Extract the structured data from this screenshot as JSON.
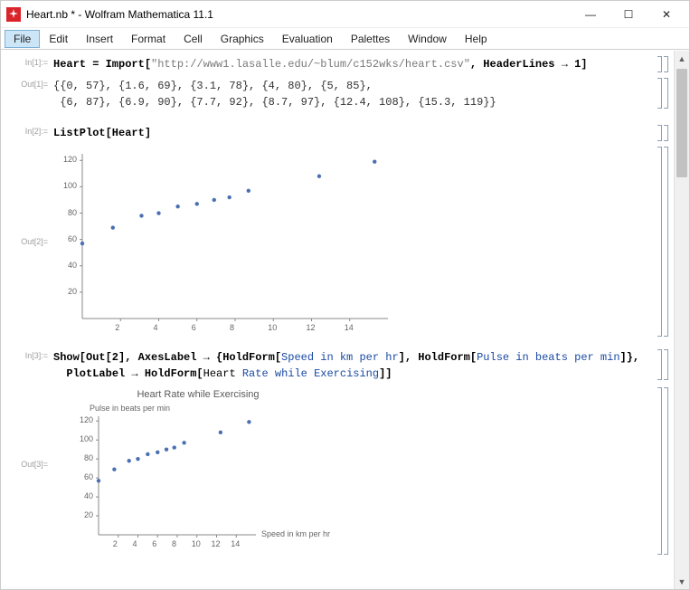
{
  "window": {
    "title": "Heart.nb * - Wolfram Mathematica 11.1",
    "minimize": "—",
    "maximize": "☐",
    "close": "✕"
  },
  "menu": [
    "File",
    "Edit",
    "Insert",
    "Format",
    "Cell",
    "Graphics",
    "Evaluation",
    "Palettes",
    "Window",
    "Help"
  ],
  "cells": {
    "in1_label": "In[1]:=",
    "in1_pre": "Heart = Import[",
    "in1_url": "\"http://www1.lasalle.edu/~blum/c152wks/heart.csv\"",
    "in1_post": ", HeaderLines → 1]",
    "out1_label": "Out[1]=",
    "out1_text": "{{0, 57}, {1.6, 69}, {3.1, 78}, {4, 80}, {5, 85},\n {6, 87}, {6.9, 90}, {7.7, 92}, {8.7, 97}, {12.4, 108}, {15.3, 119}}",
    "in2_label": "In[2]:=",
    "in2_text": "ListPlot[Heart]",
    "out2_label": "Out[2]=",
    "in3_label": "In[3]:=",
    "in3_a": "Show[Out[2], AxesLabel → {HoldForm[",
    "in3_b": "Speed in km per hr",
    "in3_c": "], HoldForm[",
    "in3_d": "Pulse in beats per min",
    "in3_e": "]},",
    "in3_f": "  PlotLabel → HoldForm[",
    "in3_g": "Heart",
    "in3_h": " Rate while Exercising",
    "in3_i": "]]",
    "out3_label": "Out[3]="
  },
  "chart_data": [
    {
      "type": "scatter",
      "title": "",
      "xlabel": "",
      "ylabel": "",
      "x_ticks": [
        2,
        4,
        6,
        8,
        10,
        12,
        14
      ],
      "y_ticks": [
        20,
        40,
        60,
        80,
        100,
        120
      ],
      "xlim": [
        0,
        16
      ],
      "ylim": [
        0,
        125
      ],
      "x": [
        0,
        1.6,
        3.1,
        4,
        5,
        6,
        6.9,
        7.7,
        8.7,
        12.4,
        15.3
      ],
      "y": [
        57,
        69,
        78,
        80,
        85,
        87,
        90,
        92,
        97,
        108,
        119
      ]
    },
    {
      "type": "scatter",
      "title": "Heart Rate while Exercising",
      "xlabel": "Speed in km per hr",
      "ylabel": "Pulse in beats per min",
      "x_ticks": [
        2,
        4,
        6,
        8,
        10,
        12,
        14
      ],
      "y_ticks": [
        20,
        40,
        60,
        80,
        100,
        120
      ],
      "xlim": [
        0,
        16
      ],
      "ylim": [
        0,
        125
      ],
      "x": [
        0,
        1.6,
        3.1,
        4,
        5,
        6,
        6.9,
        7.7,
        8.7,
        12.4,
        15.3
      ],
      "y": [
        57,
        69,
        78,
        80,
        85,
        87,
        90,
        92,
        97,
        108,
        119
      ]
    }
  ]
}
